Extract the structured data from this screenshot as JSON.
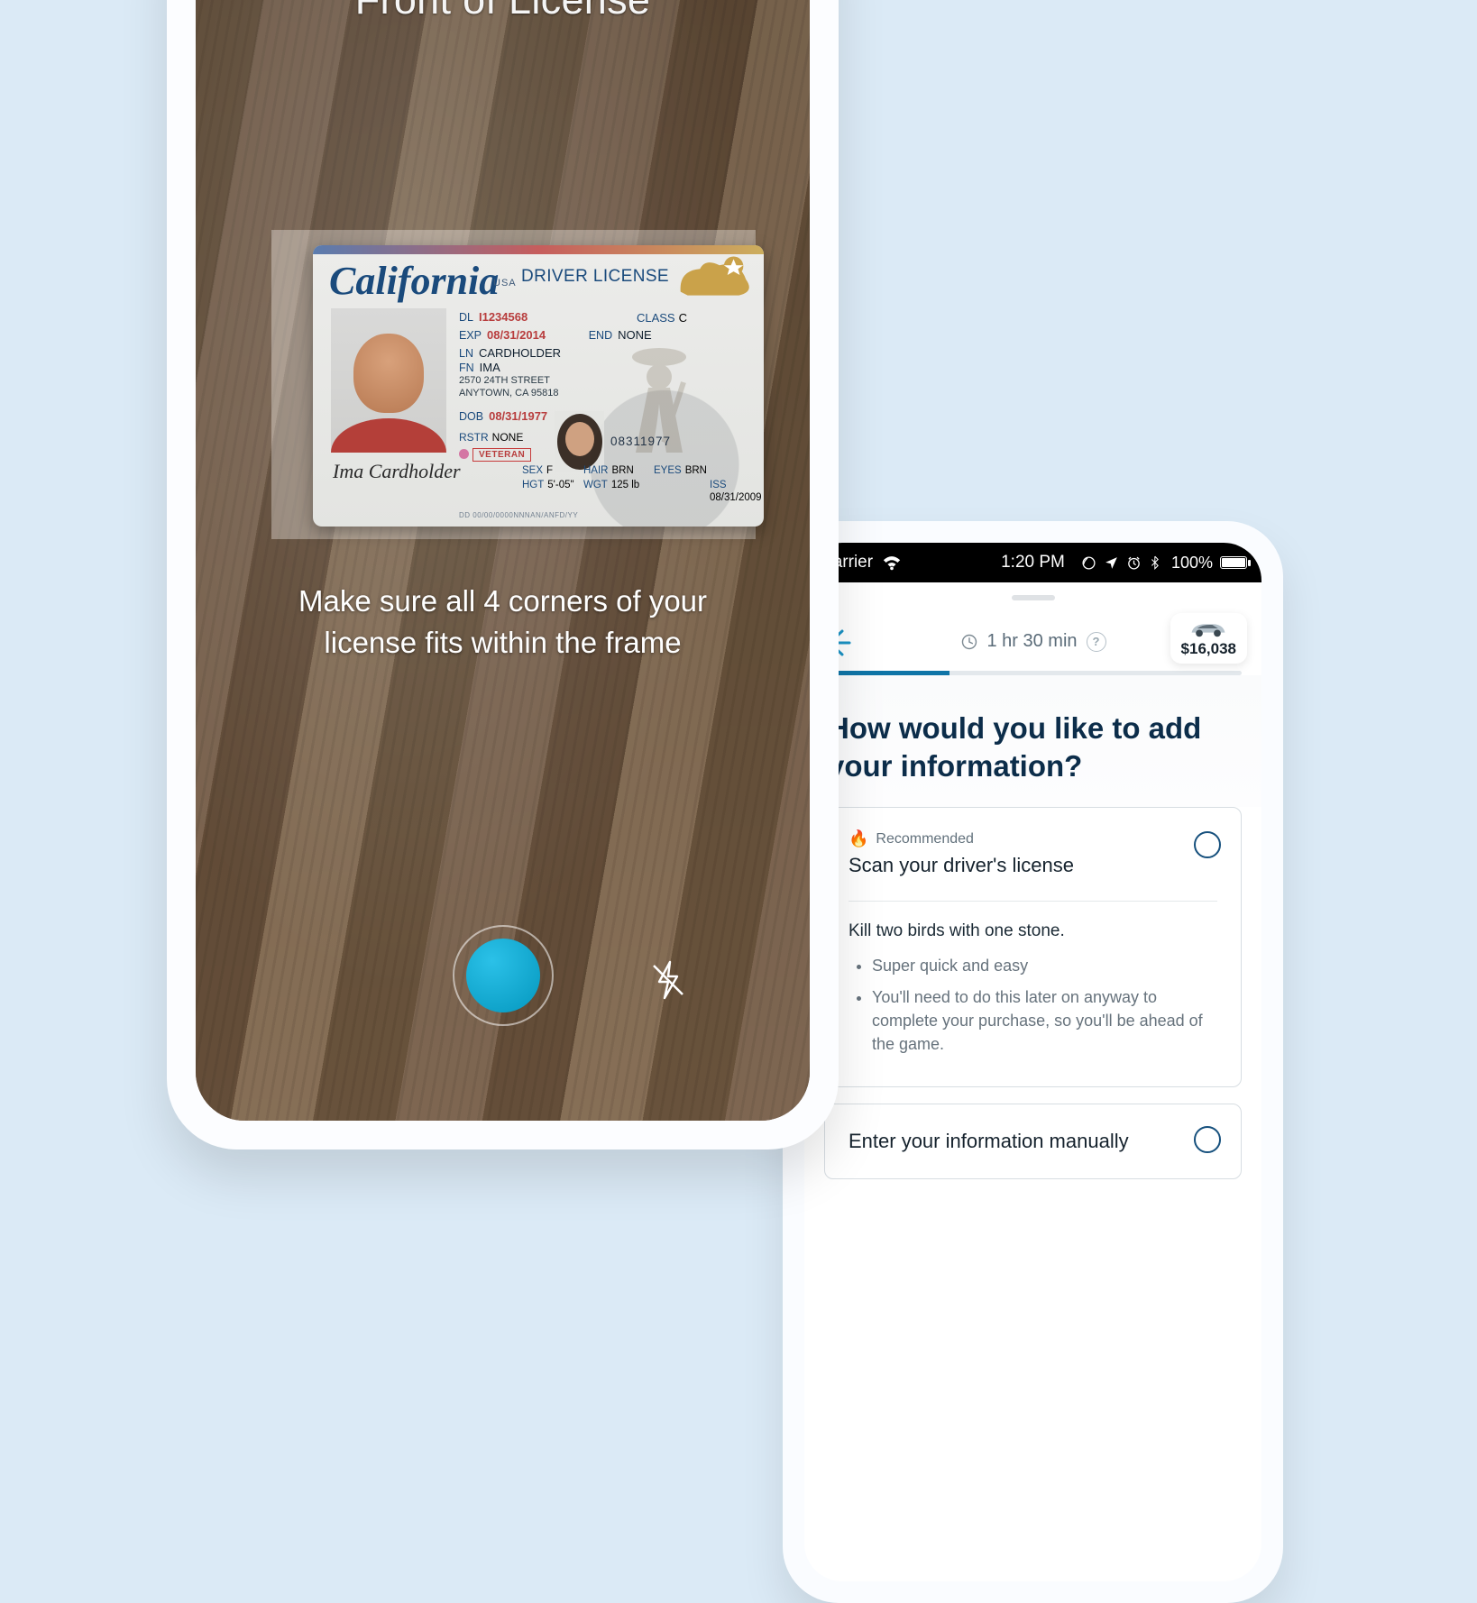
{
  "phone1": {
    "scan_title": "Front of License",
    "instruction": "Make sure all 4 corners of your license fits within the frame",
    "license": {
      "state": "California",
      "usa": "USA",
      "title": "DRIVER LICENSE",
      "dl_label": "DL",
      "dl_number": "I1234568",
      "class_label": "CLASS",
      "class_value": "C",
      "exp_label": "EXP",
      "exp_value": "08/31/2014",
      "end_label": "END",
      "end_value": "NONE",
      "ln_label": "LN",
      "ln_value": "CARDHOLDER",
      "fn_label": "FN",
      "fn_value": "IMA",
      "addr1": "2570 24TH STREET",
      "addr2": "ANYTOWN, CA 95818",
      "dob_label": "DOB",
      "dob_value": "08/31/1977",
      "rstr_label": "RSTR",
      "rstr_value": "NONE",
      "veteran": "VETERAN",
      "barcode_text": "08311977",
      "sex_label": "SEX",
      "sex_value": "F",
      "hgt_label": "HGT",
      "hgt_value": "5'-05\"",
      "hair_label": "HAIR",
      "hair_value": "BRN",
      "wgt_label": "WGT",
      "wgt_value": "125 lb",
      "eyes_label": "EYES",
      "eyes_value": "BRN",
      "iss_label": "ISS",
      "iss_value": "08/31/2009",
      "dd_label": "DD",
      "dd_value": "00/00/0000NNNAN/ANFD/YY",
      "signature": "Ima Cardholder"
    }
  },
  "phone2": {
    "status": {
      "carrier": "Carrier",
      "time": "1:20 PM",
      "battery_pct": "100%"
    },
    "nav": {
      "duration": "1 hr 30 min",
      "price": "$16,038"
    },
    "progress_pct": 30,
    "prompt": "How would you like to add your information?",
    "option_scan": {
      "recommended_label": "Recommended",
      "title": "Scan your driver's license",
      "lead": "Kill two birds with one stone.",
      "bullet1": "Super quick and easy",
      "bullet2": "You'll need to do this later on anyway to complete your purchase, so you'll be ahead of the game."
    },
    "option_manual": {
      "title": "Enter your information manually"
    }
  }
}
